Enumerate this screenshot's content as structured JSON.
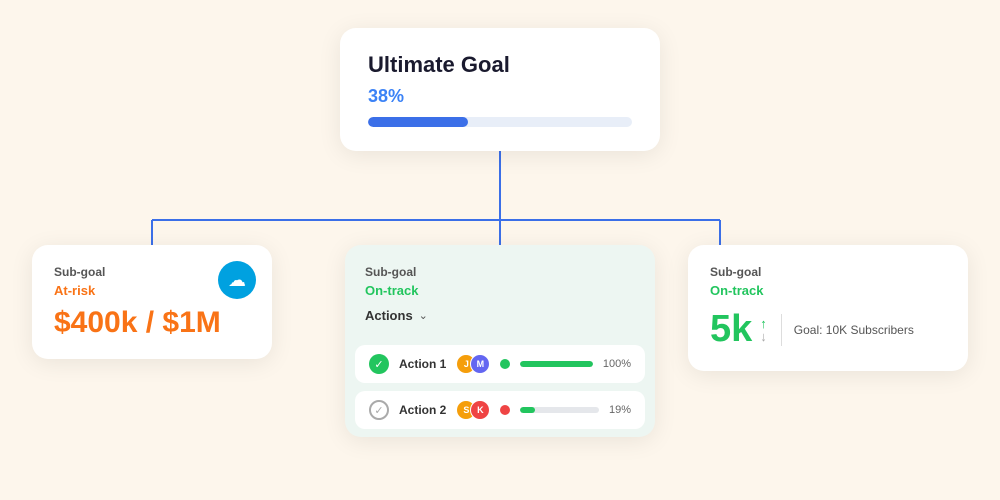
{
  "ultimate_goal": {
    "title": "Ultimate Goal",
    "percent": "38%",
    "progress": 38
  },
  "subgoal_left": {
    "label": "Sub-goal",
    "status": "At-risk",
    "value": "$400k / $1M"
  },
  "subgoal_center": {
    "label": "Sub-goal",
    "status": "On-track",
    "actions_label": "Actions",
    "actions": [
      {
        "name": "Action 1",
        "complete": true,
        "progress": 100,
        "pct": "100%",
        "dot_color": "green"
      },
      {
        "name": "Action 2",
        "complete": false,
        "progress": 19,
        "pct": "19%",
        "dot_color": "red"
      }
    ]
  },
  "subgoal_right": {
    "label": "Sub-goal",
    "status": "On-track",
    "value": "5k",
    "goal_label": "Goal: 10K Subscribers"
  },
  "salesforce": {
    "label": "salesforce"
  }
}
